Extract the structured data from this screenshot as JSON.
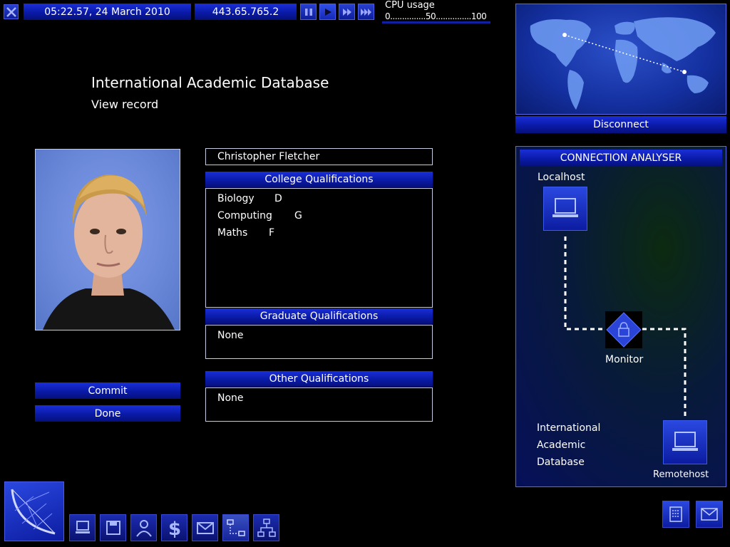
{
  "topbar": {
    "datetime": "05:22.57, 24 March 2010",
    "ip": "443.65.765.2",
    "cpu_label": "CPU usage",
    "cpu_scale": "0...............50...............100"
  },
  "header": {
    "title": "International Academic Database",
    "subtitle": "View record"
  },
  "record": {
    "name": "Christopher Fletcher",
    "college_header": "College Qualifications",
    "college": [
      {
        "subject": "Biology",
        "grade": "D"
      },
      {
        "subject": "Computing",
        "grade": "G"
      },
      {
        "subject": "Maths",
        "grade": "F"
      }
    ],
    "graduate_header": "Graduate Qualifications",
    "graduate_value": "None",
    "other_header": "Other Qualifications",
    "other_value": "None"
  },
  "actions": {
    "commit": "Commit",
    "done": "Done"
  },
  "map": {
    "disconnect": "Disconnect"
  },
  "analyser": {
    "title": "CONNECTION ANALYSER",
    "localhost": "Localhost",
    "monitor": "Monitor",
    "remote_name_1": "International",
    "remote_name_2": "Academic",
    "remote_name_3": "Database",
    "remotehost": "Remotehost"
  },
  "icons": {
    "close": "close-icon",
    "pause": "pause-icon",
    "play": "play-icon",
    "fast": "fast-forward-icon",
    "fastest": "fastest-forward-icon",
    "gateway": "satellite-dish-icon",
    "nav": [
      "computer-icon",
      "floppy-disk-icon",
      "person-icon",
      "dollar-icon",
      "envelope-icon",
      "network-icon",
      "lan-icon"
    ],
    "bottom_right": [
      "notes-icon",
      "mail-icon"
    ]
  },
  "colors": {
    "accent_blue": "#0a1aa8",
    "panel_border": "#c8cce0"
  }
}
